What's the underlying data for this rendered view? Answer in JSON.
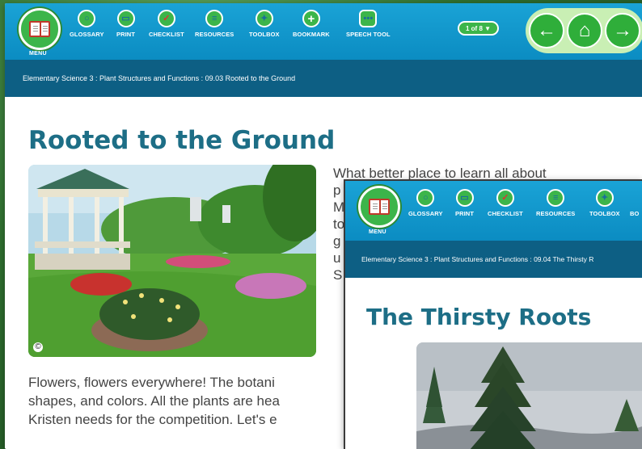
{
  "window1": {
    "menu_label": "MENU",
    "tools": [
      {
        "label": "GLOSSARY",
        "icon": "magnifier-icon"
      },
      {
        "label": "PRINT",
        "icon": "printer-icon"
      },
      {
        "label": "CHECKLIST",
        "icon": "checkmark-icon"
      },
      {
        "label": "RESOURCES",
        "icon": "list-icon"
      },
      {
        "label": "TOOLBOX",
        "icon": "wrench-icon"
      },
      {
        "label": "BOOKMARK",
        "icon": "plus-icon"
      },
      {
        "label": "SPEECH TOOL",
        "icon": "speech-bubble-icon"
      }
    ],
    "pager": "1 of 8 ▼",
    "nav": {
      "back": "←",
      "home": "⌂",
      "forward": "→"
    },
    "breadcrumb": "Elementary Science 3 : Plant Structures and Functions : 09.03 Rooted to the Ground",
    "title": "Rooted to the Ground",
    "intro_lines": [
      "What better place to learn all about",
      "p",
      "M",
      "to",
      "g",
      "u",
      "S"
    ],
    "paragraph_lines": [
      "Flowers, flowers everywhere! The botani",
      "shapes, and colors. All the plants are hea",
      "Kristen needs for the competition. Let's e"
    ],
    "copyright_mark": "©"
  },
  "window2": {
    "menu_label": "MENU",
    "tools": [
      {
        "label": "GLOSSARY",
        "icon": "magnifier-icon"
      },
      {
        "label": "PRINT",
        "icon": "printer-icon"
      },
      {
        "label": "CHECKLIST",
        "icon": "checkmark-icon"
      },
      {
        "label": "RESOURCES",
        "icon": "list-icon"
      },
      {
        "label": "TOOLBOX",
        "icon": "wrench-icon"
      },
      {
        "label": "BO",
        "icon": ""
      }
    ],
    "breadcrumb": "Elementary Science 3 : Plant Structures and Functions : 09.04 The Thirsty R",
    "title": "The Thirsty Roots"
  },
  "colors": {
    "toolbar": "#0b8cc2",
    "breadcrumb_bar": "#0d5f84",
    "accent_green": "#3cb54a",
    "title_teal": "#1d6e86"
  }
}
